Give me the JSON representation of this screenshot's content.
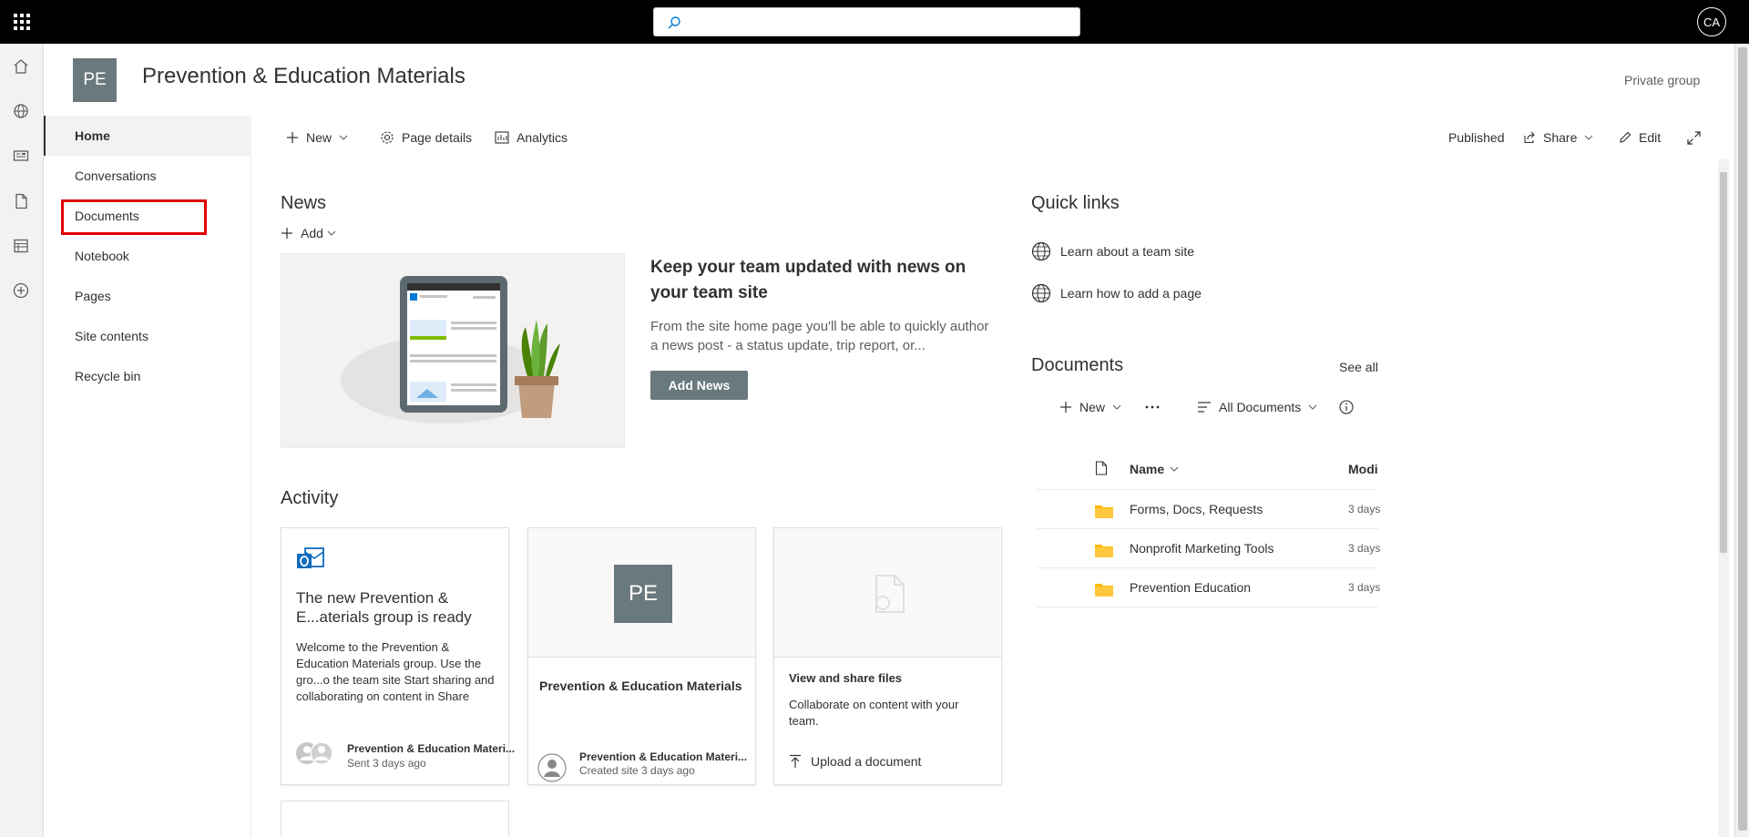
{
  "search": {
    "placeholder": ""
  },
  "user": {
    "initials": "CA"
  },
  "site": {
    "logo_initials": "PE",
    "title": "Prevention & Education Materials",
    "privacy": "Private group"
  },
  "nav": {
    "items": [
      {
        "label": "Home"
      },
      {
        "label": "Conversations"
      },
      {
        "label": "Documents"
      },
      {
        "label": "Notebook"
      },
      {
        "label": "Pages"
      },
      {
        "label": "Site contents"
      },
      {
        "label": "Recycle bin"
      }
    ]
  },
  "commandbar": {
    "new": "New",
    "page_details": "Page details",
    "analytics": "Analytics",
    "published": "Published",
    "share": "Share",
    "edit": "Edit"
  },
  "news": {
    "heading": "News",
    "add": "Add",
    "title": "Keep your team updated with news on your team site",
    "description": "From the site home page you'll be able to quickly author a news post - a status update, trip report, or...",
    "add_news_button": "Add News"
  },
  "activity": {
    "heading": "Activity",
    "card1": {
      "title": "The new Prevention & E...aterials group is ready",
      "description": "Welcome to the Prevention & Education Materials group. Use the gro...o the team site Start sharing and collaborating on content in Share",
      "author": "Prevention & Education Materi...",
      "meta": "Sent 3 days ago"
    },
    "card2": {
      "logo_initials": "PE",
      "title": "Prevention & Education Materials",
      "author": "Prevention & Education Materi...",
      "meta": "Created site 3 days ago"
    },
    "card3": {
      "title": "View and share files",
      "description": "Collaborate on content with your team.",
      "action": "Upload a document"
    }
  },
  "quicklinks": {
    "heading": "Quick links",
    "items": [
      {
        "label": "Learn about a team site"
      },
      {
        "label": "Learn how to add a page"
      }
    ]
  },
  "documents": {
    "heading": "Documents",
    "see_all": "See all",
    "new": "New",
    "view": "All Documents",
    "columns": {
      "name": "Name",
      "modified": "Modi"
    },
    "rows": [
      {
        "name": "Forms, Docs, Requests",
        "modified": "3 days"
      },
      {
        "name": "Nonprofit Marketing Tools",
        "modified": "3 days"
      },
      {
        "name": "Prevention Education",
        "modified": "3 days"
      }
    ]
  },
  "colors": {
    "site_logo_bg": "#69797e",
    "highlight_box": "#e00000",
    "folder": "#ffb900"
  }
}
